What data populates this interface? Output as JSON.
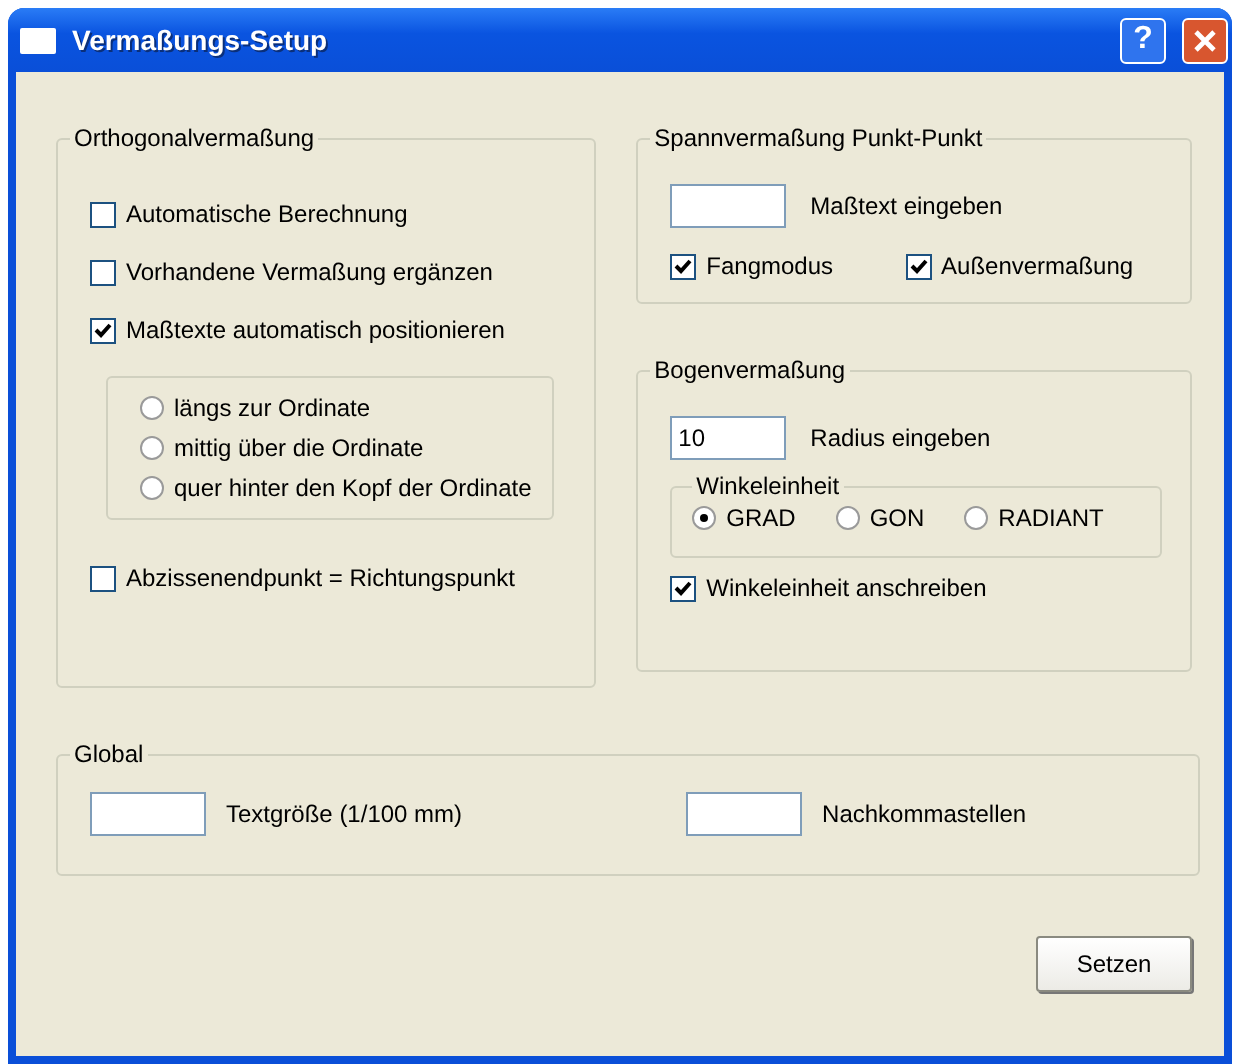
{
  "window": {
    "title": "Vermaßungs-Setup",
    "help_label": "?"
  },
  "orthogonal": {
    "title": "Orthogonalvermaßung",
    "options": [
      {
        "label": "Automatische Berechnung",
        "checked": false
      },
      {
        "label": "Vorhandene Vermaßung ergänzen",
        "checked": false
      },
      {
        "label": "Maßtexte automatisch positionieren",
        "checked": true
      }
    ],
    "positions": [
      {
        "label": "längs zur Ordinate",
        "selected": false
      },
      {
        "label": "mittig über die Ordinate",
        "selected": false
      },
      {
        "label": "quer hinter den Kopf der Ordinate",
        "selected": false
      }
    ],
    "endpoint": {
      "label": "Abzissenendpunkt = Richtungspunkt",
      "checked": false
    }
  },
  "span": {
    "title": "Spannvermaßung Punkt-Punkt",
    "field": {
      "label": "Maßtext eingeben"
    },
    "options": [
      {
        "label": "Fangmodus",
        "checked": true
      },
      {
        "label": "Außenvermaßung",
        "checked": true
      }
    ]
  },
  "arc": {
    "title": "Bogenvermaßung",
    "field": {
      "value": "10",
      "label": "Radius eingeben"
    },
    "unit_title": "Winkeleinheit",
    "units": [
      {
        "label": "GRAD",
        "selected": true
      },
      {
        "label": "GON",
        "selected": false
      },
      {
        "label": "RADIANT",
        "selected": false
      }
    ],
    "write_unit": {
      "label": "Winkeleinheit anschreiben",
      "checked": true
    }
  },
  "global": {
    "title": "Global",
    "fields": [
      {
        "label": "Textgröße (1/100 mm)"
      },
      {
        "label": "Nachkommastellen"
      }
    ]
  },
  "button": "Setzen"
}
